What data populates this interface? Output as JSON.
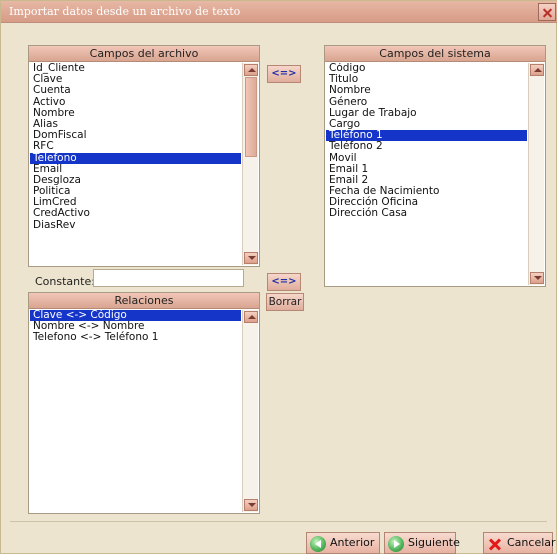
{
  "window": {
    "title": "Importar datos desde un archivo de texto"
  },
  "file_fields": {
    "header": "Campos del archivo",
    "items": [
      "Id_Cliente",
      "Clave",
      "Cuenta",
      "Activo",
      "Nombre",
      "Alias",
      "DomFiscal",
      "RFC",
      "Telefono",
      "Email",
      "Desgloza",
      "Politica",
      "LimCred",
      "CredActivo",
      "DiasRev"
    ],
    "selected_index": 8
  },
  "system_fields": {
    "header": "Campos del sistema",
    "items": [
      "Código",
      "Titulo",
      "Nombre",
      "Género",
      "Lugar de Trabajo",
      "Cargo",
      "Teléfono 1",
      "Teléfono 2",
      "Movil",
      "Email 1",
      "Email 2",
      "Fecha de Nacimiento",
      "Dirección Oficina",
      "Dirección Casa"
    ],
    "selected_index": 6
  },
  "relations": {
    "header": "Relaciones",
    "items": [
      "Clave <-> Código",
      "Nombre <-> Nombre",
      "Telefono <-> Teléfono 1"
    ],
    "selected_index": 0
  },
  "buttons": {
    "swap_top": "<=>",
    "swap_mid": "<=>",
    "borrar": "Borrar",
    "anterior": "Anterior",
    "siguiente": "Siguiente",
    "cancelar": "Cancelar"
  },
  "constant": {
    "label": "Constante:",
    "value": ""
  }
}
